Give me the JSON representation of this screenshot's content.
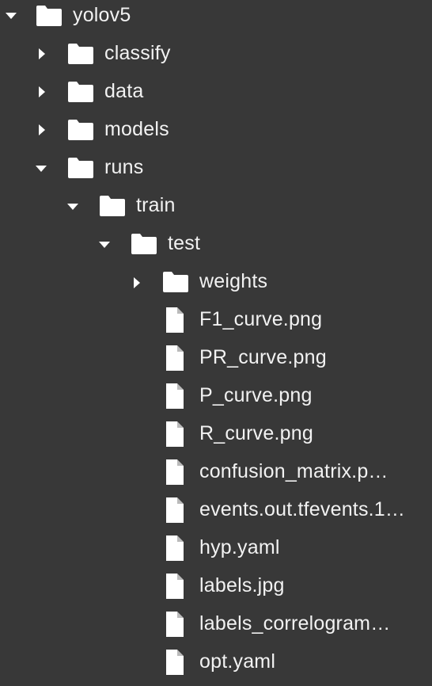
{
  "file_tree": {
    "root": {
      "label": "yolov5",
      "expanded": true,
      "icon": "folder-icon"
    },
    "level1": [
      {
        "label": "classify",
        "expanded": false,
        "icon": "folder-icon"
      },
      {
        "label": "data",
        "expanded": false,
        "icon": "folder-icon"
      },
      {
        "label": "models",
        "expanded": false,
        "icon": "folder-icon"
      },
      {
        "label": "runs",
        "expanded": true,
        "icon": "folder-icon"
      }
    ],
    "train": {
      "label": "train",
      "expanded": true,
      "icon": "folder-icon"
    },
    "test": {
      "label": "test",
      "expanded": true,
      "icon": "folder-icon"
    },
    "weights": {
      "label": "weights",
      "expanded": false,
      "icon": "folder-icon"
    },
    "files": [
      {
        "label": "F1_curve.png",
        "icon": "file-icon"
      },
      {
        "label": "PR_curve.png",
        "icon": "file-icon"
      },
      {
        "label": "P_curve.png",
        "icon": "file-icon"
      },
      {
        "label": "R_curve.png",
        "icon": "file-icon"
      },
      {
        "label": "confusion_matrix.p…",
        "icon": "file-icon"
      },
      {
        "label": "events.out.tfevents.1…",
        "icon": "file-icon"
      },
      {
        "label": "hyp.yaml",
        "icon": "file-icon"
      },
      {
        "label": "labels.jpg",
        "icon": "file-icon"
      },
      {
        "label": "labels_correlogram…",
        "icon": "file-icon"
      },
      {
        "label": "opt.yaml",
        "icon": "file-icon"
      }
    ]
  },
  "colors": {
    "background": "#383838",
    "text": "#f2f2f2",
    "icon": "#ffffff"
  }
}
